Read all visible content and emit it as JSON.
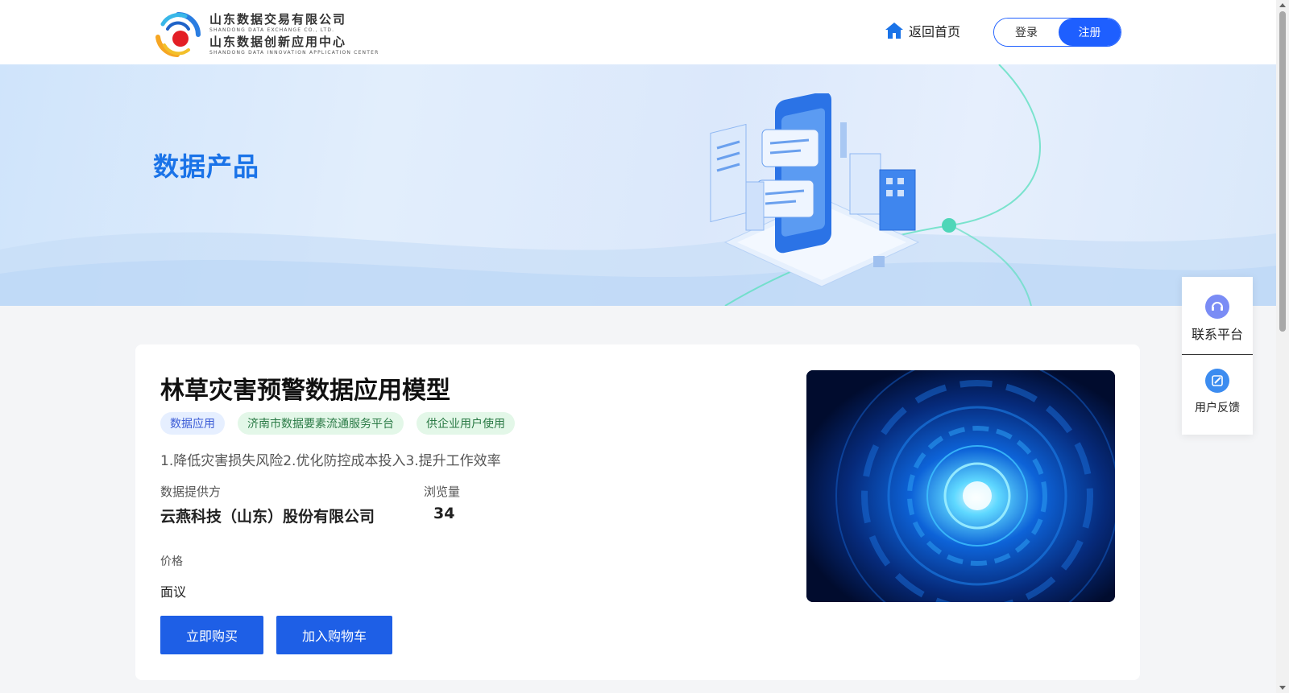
{
  "header": {
    "logo": {
      "line1_cn": "山东数据交易有限公司",
      "line1_en": "SHANDONG DATA EXCHANGE CO., LTD.",
      "line2_cn": "山东数据创新应用中心",
      "line2_en": "SHANDONG DATA INNOVATION APPLICATION CENTER"
    },
    "home_label": "返回首页",
    "login_label": "登录",
    "register_label": "注册"
  },
  "banner": {
    "title": "数据产品"
  },
  "product": {
    "title": "林草灾害预警数据应用模型",
    "tags": [
      "数据应用",
      "济南市数据要素流通服务平台",
      "供企业用户使用"
    ],
    "description": "1.降低灾害损失风险2.优化防控成本投入3.提升工作效率",
    "provider_label": "数据提供方",
    "provider_value": "云燕科技（山东）股份有限公司",
    "views_label": "浏览量",
    "views_value": "34",
    "price_label": "价格",
    "price_value": "面议",
    "buy_label": "立即购买",
    "cart_label": "加入购物车"
  },
  "side_panel": {
    "contact_label": "联系平台",
    "feedback_label": "用户反馈"
  },
  "colors": {
    "primary": "#1e5fe6",
    "banner_title": "#1a73e8",
    "tag_blue_bg": "#e6efff",
    "tag_green_bg": "#e3f7e8"
  }
}
